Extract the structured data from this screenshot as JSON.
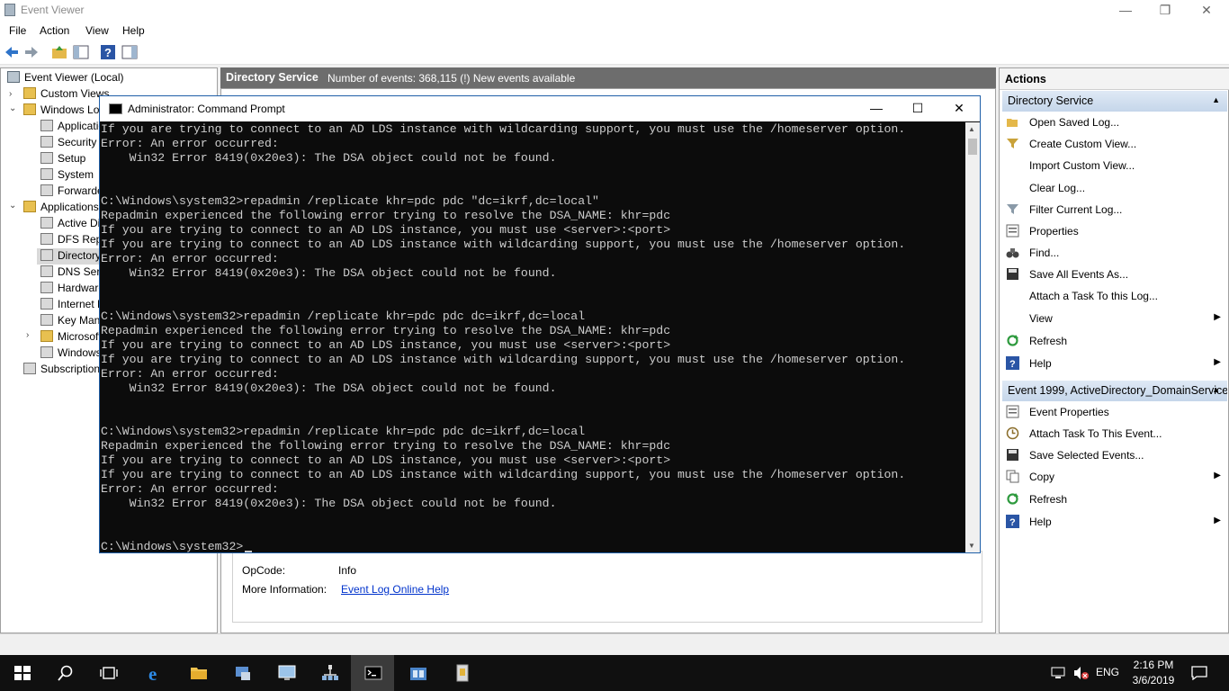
{
  "event_viewer": {
    "title": "Event Viewer",
    "menu": [
      "File",
      "Action",
      "View",
      "Help"
    ],
    "window_controls": {
      "minimize": "—",
      "restore": "❐",
      "close": "✕"
    },
    "tree": [
      {
        "label": "Event Viewer (Local)",
        "twist": ""
      },
      {
        "label": "Custom Views",
        "twist": "›"
      },
      {
        "label": "Windows Logs",
        "twist": "⌄"
      },
      {
        "label": "Application",
        "twist": ""
      },
      {
        "label": "Security",
        "twist": ""
      },
      {
        "label": "Setup",
        "twist": ""
      },
      {
        "label": "System",
        "twist": ""
      },
      {
        "label": "Forwarded Events",
        "twist": ""
      },
      {
        "label": "Applications and Services Logs",
        "twist": "⌄"
      },
      {
        "label": "Active Directory Web Services",
        "twist": ""
      },
      {
        "label": "DFS Replication",
        "twist": ""
      },
      {
        "label": "Directory Service",
        "twist": ""
      },
      {
        "label": "DNS Server",
        "twist": ""
      },
      {
        "label": "Hardware Events",
        "twist": ""
      },
      {
        "label": "Internet Explorer",
        "twist": ""
      },
      {
        "label": "Key Management Service",
        "twist": ""
      },
      {
        "label": "Microsoft",
        "twist": "›"
      },
      {
        "label": "Windows PowerShell",
        "twist": ""
      },
      {
        "label": "Subscriptions",
        "twist": ""
      }
    ],
    "center": {
      "title": "Directory Service",
      "subtitle": "Number of events: 368,115 (!) New events available"
    },
    "details": {
      "opcode_label": "OpCode:",
      "opcode_value": "Info",
      "more_info_label": "More Information:",
      "more_info_link": "Event Log Online Help"
    },
    "actions": {
      "title": "Actions",
      "section1": "Directory Service",
      "section1_items": [
        {
          "label": "Open Saved Log...",
          "icon": "folder-open-icon",
          "arrow": ""
        },
        {
          "label": "Create Custom View...",
          "icon": "filter-icon",
          "arrow": ""
        },
        {
          "label": "Import Custom View...",
          "icon": "",
          "arrow": ""
        },
        {
          "label": "Clear Log...",
          "icon": "",
          "arrow": ""
        },
        {
          "label": "Filter Current Log...",
          "icon": "filter-icon",
          "arrow": ""
        },
        {
          "label": "Properties",
          "icon": "properties-icon",
          "arrow": ""
        },
        {
          "label": "Find...",
          "icon": "binoculars-icon",
          "arrow": ""
        },
        {
          "label": "Save All Events As...",
          "icon": "save-icon",
          "arrow": ""
        },
        {
          "label": "Attach a Task To this Log...",
          "icon": "",
          "arrow": ""
        },
        {
          "label": "View",
          "icon": "",
          "arrow": "▶"
        },
        {
          "label": "Refresh",
          "icon": "refresh-icon",
          "arrow": ""
        },
        {
          "label": "Help",
          "icon": "help-icon",
          "arrow": "▶"
        }
      ],
      "section2": "Event 1999, ActiveDirectory_DomainService",
      "section2_items": [
        {
          "label": "Event Properties",
          "icon": "properties-icon",
          "arrow": ""
        },
        {
          "label": "Attach Task To This Event...",
          "icon": "task-icon",
          "arrow": ""
        },
        {
          "label": "Save Selected Events...",
          "icon": "save-icon",
          "arrow": ""
        },
        {
          "label": "Copy",
          "icon": "copy-icon",
          "arrow": "▶"
        },
        {
          "label": "Refresh",
          "icon": "refresh-icon",
          "arrow": ""
        },
        {
          "label": "Help",
          "icon": "help-icon",
          "arrow": "▶"
        }
      ]
    }
  },
  "cmd": {
    "title": "Administrator: Command Prompt",
    "window_controls": {
      "minimize": "—",
      "maximize": "☐",
      "close": "✕"
    },
    "lines": [
      "If you are trying to connect to an AD LDS instance with wildcarding support, you must use the /homeserver option.",
      "Error: An error occurred:",
      "    Win32 Error 8419(0x20e3): The DSA object could not be found.",
      "",
      "",
      "C:\\Windows\\system32>repadmin /replicate khr=pdc pdc \"dc=ikrf,dc=local\"",
      "Repadmin experienced the following error trying to resolve the DSA_NAME: khr=pdc",
      "If you are trying to connect to an AD LDS instance, you must use <server>:<port>",
      "If you are trying to connect to an AD LDS instance with wildcarding support, you must use the /homeserver option.",
      "Error: An error occurred:",
      "    Win32 Error 8419(0x20e3): The DSA object could not be found.",
      "",
      "",
      "C:\\Windows\\system32>repadmin /replicate khr=pdc pdc dc=ikrf,dc=local",
      "Repadmin experienced the following error trying to resolve the DSA_NAME: khr=pdc",
      "If you are trying to connect to an AD LDS instance, you must use <server>:<port>",
      "If you are trying to connect to an AD LDS instance with wildcarding support, you must use the /homeserver option.",
      "Error: An error occurred:",
      "    Win32 Error 8419(0x20e3): The DSA object could not be found.",
      "",
      "",
      "C:\\Windows\\system32>repadmin /replicate khr=pdc pdc dc=ikrf,dc=local",
      "Repadmin experienced the following error trying to resolve the DSA_NAME: khr=pdc",
      "If you are trying to connect to an AD LDS instance, you must use <server>:<port>",
      "If you are trying to connect to an AD LDS instance with wildcarding support, you must use the /homeserver option.",
      "Error: An error occurred:",
      "    Win32 Error 8419(0x20e3): The DSA object could not be found.",
      "",
      "",
      "C:\\Windows\\system32>"
    ]
  },
  "taskbar": {
    "apps": [
      {
        "name": "start-icon",
        "active": false
      },
      {
        "name": "search-icon",
        "active": false
      },
      {
        "name": "task-view-icon",
        "active": false
      },
      {
        "name": "internet-explorer-icon",
        "active": false
      },
      {
        "name": "file-explorer-icon",
        "active": false
      },
      {
        "name": "server-manager-icon",
        "active": false
      },
      {
        "name": "remote-desktop-icon",
        "active": false
      },
      {
        "name": "network-tool-icon",
        "active": false
      },
      {
        "name": "command-prompt-icon",
        "active": true
      },
      {
        "name": "ad-users-icon",
        "active": false
      },
      {
        "name": "event-viewer-icon",
        "active": false
      }
    ],
    "language": "ENG",
    "time": "2:16 PM",
    "date": "3/6/2019"
  },
  "colors": {
    "console_bg": "#0c0c0c",
    "console_text": "#cccccc",
    "center_header_bg": "#6d6d6d",
    "actions_section_bg": "#c5d6ea",
    "taskbar_bg": "#101010"
  }
}
